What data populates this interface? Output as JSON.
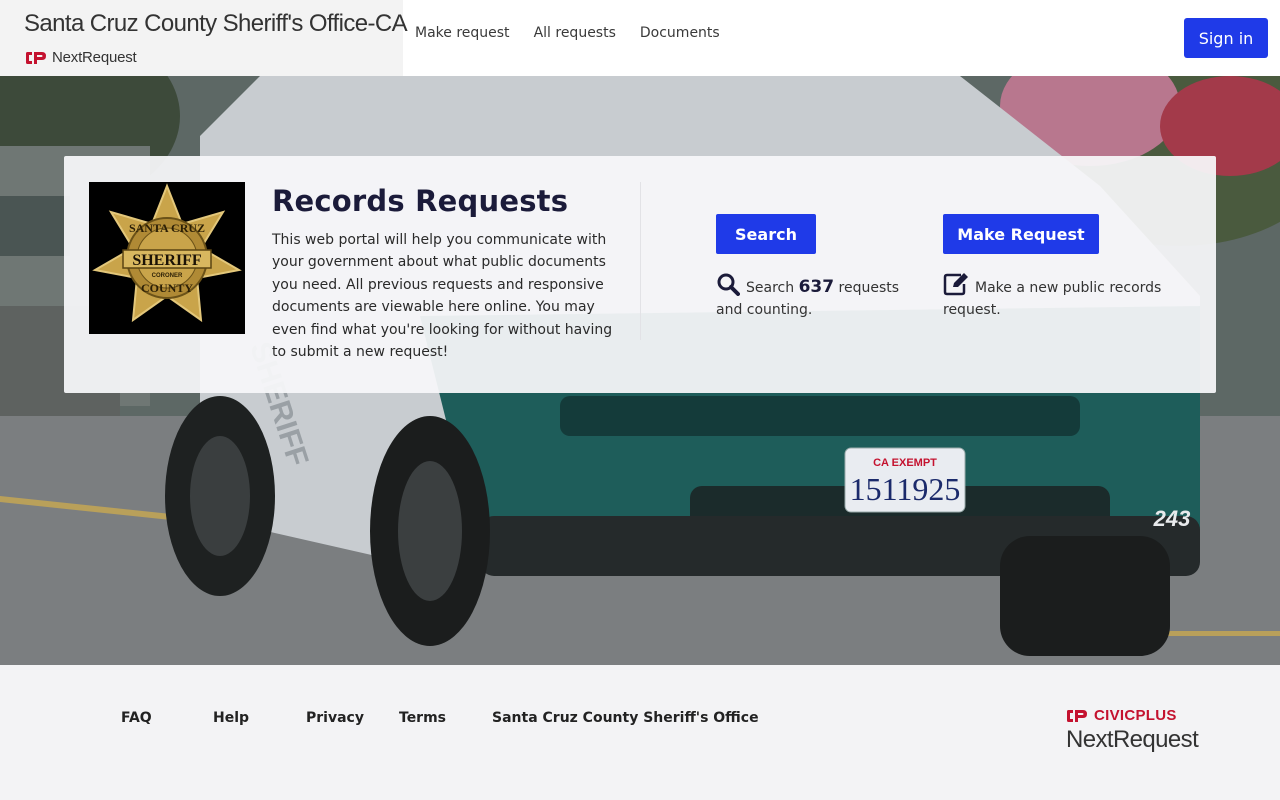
{
  "header": {
    "site_title": "Santa Cruz County Sheriff's Office-CA",
    "logo_text": "NextRequest",
    "nav": [
      "Make request",
      "All requests",
      "Documents"
    ],
    "sign_in_label": "Sign in"
  },
  "hero": {
    "badge": {
      "top_text": "SANTA CRUZ",
      "center_text": "SHERIFF",
      "small_text": "CORONER",
      "bottom_text": "COUNTY"
    },
    "title": "Records Requests",
    "description": "This web portal will help you communicate with your government about what public documents you need. All previous requests and responsive documents are viewable here online. You may even find what you're looking for without having to submit a new request!",
    "search_button": "Search",
    "search_note_prefix": "Search",
    "request_count": "637",
    "search_note_suffix": "requests and counting.",
    "make_request_button": "Make Request",
    "make_request_note": "Make a new public records request.",
    "photo": {
      "plate_top": "CA EXEMPT",
      "plate_number": "1511925",
      "unit_number": "243",
      "door_text": "SHERIFF"
    }
  },
  "footer": {
    "links": [
      "FAQ",
      "Help",
      "Privacy",
      "Terms",
      "Santa Cruz County Sheriff's Office"
    ],
    "brand_top": "CIVICPLUS",
    "brand_bottom": "NextRequest"
  },
  "colors": {
    "primary": "#1f3ae8",
    "brand_red": "#c4122f",
    "title_navy": "#1b1b3a",
    "badge_gold": "#c9a44a"
  },
  "icons": {
    "search": "magnifier-icon",
    "edit": "pencil-square-icon",
    "brand": "civicplus-cp-icon"
  }
}
